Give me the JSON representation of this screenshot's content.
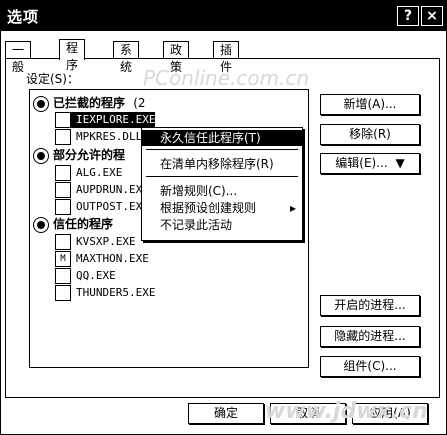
{
  "window": {
    "title": "选项",
    "help_glyph": "?",
    "close_glyph": "×"
  },
  "tabs": [
    {
      "label": "一般"
    },
    {
      "label": "程序"
    },
    {
      "label": "系统"
    },
    {
      "label": "政策"
    },
    {
      "label": "插件"
    }
  ],
  "settings_label": "设定(S)：",
  "groups": {
    "blocked": {
      "label": "已拦截的程序",
      "count": "(2"
    },
    "partial": {
      "label": "部分允许的程"
    },
    "trusted": {
      "label": "信任的程序"
    }
  },
  "blocked_items": [
    "IEXPLORE.EXE",
    "MPKRES.DLL"
  ],
  "partial_items": [
    "ALG.EXE",
    "AUPDRUN.EX",
    "OUTPOST.EX"
  ],
  "trusted_items": [
    "KVSXP.EXE",
    "MAXTHON.EXE",
    "QQ.EXE",
    "THUNDER5.EXE"
  ],
  "context_menu": {
    "trust_forever": "永久信任此程序(T)",
    "remove_from_list": "在清单内移除程序(R)",
    "new_rule": "新增规则(C)...",
    "create_from_preset": "根据预设创建规则",
    "submenu_arrow": "▸",
    "ignore_activity": "不记录此活动"
  },
  "buttons": {
    "add": "新增(A)...",
    "remove": "移除(R)",
    "edit": "编辑(E)...",
    "edit_arrow": "▼",
    "open_processes": "开启的进程...",
    "hidden_processes": "隐藏的进程...",
    "components": "组件(C)...",
    "ok": "确定",
    "cancel": "取消",
    "apply": "应用(A)"
  },
  "watermarks": {
    "top": "PConline.com.cn",
    "bottom": "www.jdwx.cn"
  }
}
